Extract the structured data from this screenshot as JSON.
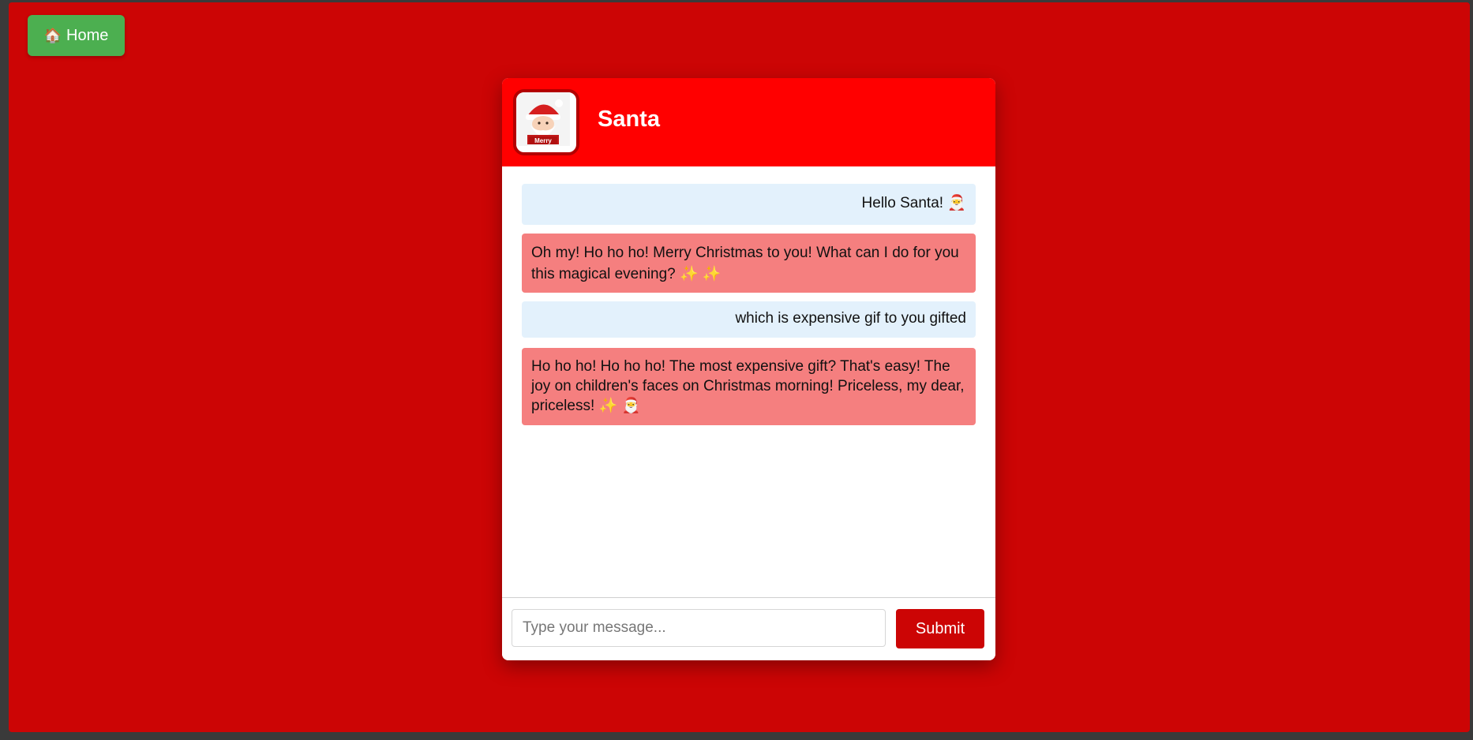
{
  "nav": {
    "home_icon": "🏠",
    "home_label": "Home"
  },
  "chat": {
    "title": "Santa",
    "avatar_label": "Merry",
    "messages": [
      {
        "sender": "user",
        "text": "Hello Santa! 🎅"
      },
      {
        "sender": "santa",
        "text": "Oh my! Ho ho ho! Merry Christmas to you! What can I do for you this magical evening? ✨ ✨"
      },
      {
        "sender": "user",
        "text": "which is expensive gif to you gifted"
      },
      {
        "sender": "santa",
        "text": "Ho ho ho! Ho ho ho! The most expensive gift? That's easy! The joy on children's faces on Christmas morning! Priceless, my dear, priceless! ✨ 🎅"
      }
    ]
  },
  "input": {
    "placeholder": "Type your message...",
    "value": "",
    "submit_label": "Submit"
  },
  "colors": {
    "page_background": "#cc0505",
    "header_background": "#ff0000",
    "home_button": "#4caf50",
    "user_bubble": "#e3f1fc",
    "santa_bubble": "#f57f7f",
    "submit_button": "#cc0505"
  }
}
